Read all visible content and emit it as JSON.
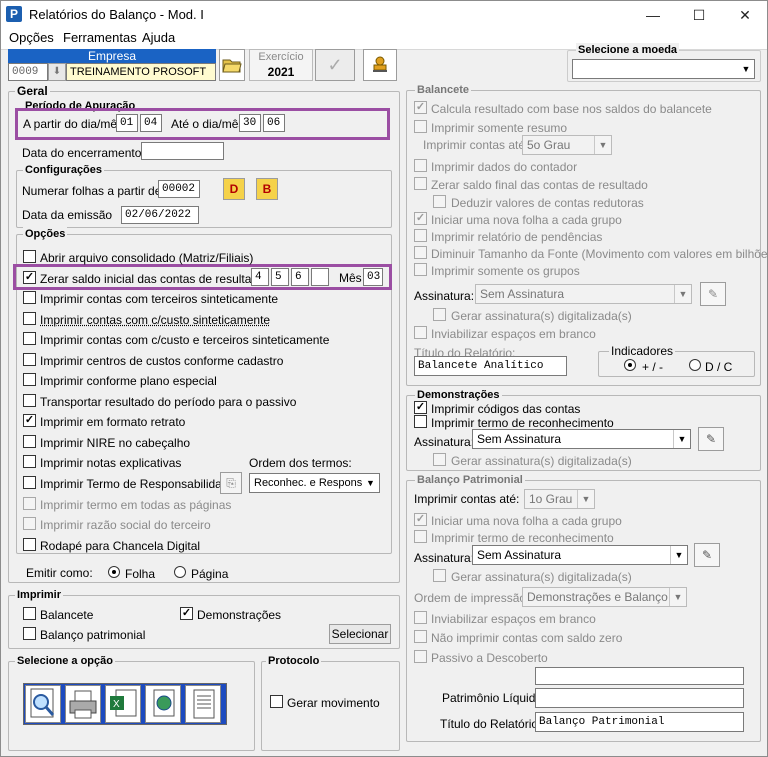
{
  "window": {
    "title": "Relatórios do Balanço - Mod. I",
    "minimize": "—",
    "maximize": "☐",
    "close": "✕",
    "app_icon": "P"
  },
  "menu": [
    "Opções",
    "Ferramentas",
    "Ajuda"
  ],
  "empresa": {
    "header": "Empresa",
    "code": "0009",
    "name": "TREINAMENTO PROSOFT"
  },
  "exercicio": {
    "label": "Exercício",
    "value": "2021"
  },
  "moeda": {
    "legend": "Selecione a moeda",
    "value": ""
  },
  "geral": {
    "legend": "Geral",
    "periodo": {
      "legend": "Período de Apuração",
      "from_label": "A partir do dia/mês",
      "from_day": "01",
      "from_month": "04",
      "to_label": "Até o dia/mês",
      "to_day": "30",
      "to_month": "06"
    },
    "encerramento_label": "Data do encerramento",
    "encerramento_value": "",
    "config": {
      "legend": "Configurações",
      "numerar_label": "Numerar folhas a partir de",
      "numerar_value": "00002",
      "btn_d": "D",
      "btn_b": "B",
      "emissao_label": "Data da emissão",
      "emissao_value": "02/06/2022"
    },
    "opcoes": {
      "legend": "Opções",
      "items": [
        {
          "label": "Abrir arquivo consolidado (Matriz/Filiais)",
          "checked": false,
          "disabled": false
        },
        {
          "label": "Zerar saldo inicial das contas de resultado",
          "checked": true,
          "disabled": false
        },
        {
          "label": "Imprimir contas com terceiros sinteticamente",
          "checked": false,
          "disabled": false
        },
        {
          "label": "Imprimir contas com c/custo sinteticamente",
          "checked": false,
          "disabled": false
        },
        {
          "label": "Imprimir contas com c/custo e terceiros sinteticamente",
          "checked": false,
          "disabled": false
        },
        {
          "label": "Imprimir centros de custos conforme cadastro",
          "checked": false,
          "disabled": false
        },
        {
          "label": "Imprimir conforme plano especial",
          "checked": false,
          "disabled": false
        },
        {
          "label": "Transportar resultado do período para o passivo",
          "checked": false,
          "disabled": false
        },
        {
          "label": "Imprimir em formato retrato",
          "checked": true,
          "disabled": false
        },
        {
          "label": "Imprimir NIRE no cabeçalho",
          "checked": false,
          "disabled": false
        },
        {
          "label": "Imprimir notas explicativas",
          "checked": false,
          "disabled": false
        },
        {
          "label": "Imprimir Termo de Responsabilidade",
          "checked": false,
          "disabled": false
        },
        {
          "label": "Imprimir termo em todas as páginas",
          "checked": false,
          "disabled": true
        },
        {
          "label": "Imprimir razão social do terceiro",
          "checked": false,
          "disabled": true
        },
        {
          "label": "Rodapé para Chancela Digital",
          "checked": false,
          "disabled": false
        }
      ],
      "zerar_months": [
        "4",
        "5",
        "6",
        ""
      ],
      "mes_label": "Mês",
      "mes_value": "03",
      "ordem_label": "Ordem dos termos:",
      "ordem_value": "Reconhec. e Respons."
    },
    "emitir": {
      "label": "Emitir como:",
      "folha": "Folha",
      "pagina": "Página"
    }
  },
  "imprimir": {
    "legend": "Imprimir",
    "balancete": "Balancete",
    "demonstracoes": "Demonstrações",
    "balanco": "Balanço patrimonial",
    "selecionar": "Selecionar"
  },
  "opcao": {
    "legend": "Selecione a opção"
  },
  "protocolo": {
    "legend": "Protocolo",
    "gerar": "Gerar movimento"
  },
  "balancete": {
    "legend": "Balancete",
    "items": [
      "Calcula resultado com base nos saldos do balancete",
      "Imprimir somente resumo",
      "Imprimir dados do contador",
      "Zerar saldo final das contas de resultado",
      "Deduzir valores de contas redutoras",
      "Iniciar uma nova folha a cada grupo",
      "Imprimir relatório de pendências",
      "Diminuir Tamanho da Fonte (Movimento com valores em bilhões)",
      "Imprimir somente os grupos",
      "Gerar assinatura(s) digitalizada(s)",
      "Inviabilizar espaços em branco"
    ],
    "contas_ate_label": "Imprimir contas até:",
    "contas_ate_value": "5o Grau",
    "assinatura_label": "Assinatura:",
    "assinatura_value": "Sem Assinatura",
    "titulo_label": "Título do Relatório:",
    "titulo_value": "Balancete Analítico",
    "indicadores": {
      "legend": "Indicadores",
      "opt1": "+ / -",
      "opt2": "D / C"
    }
  },
  "demonstracoes": {
    "legend": "Demonstrações",
    "codigos": "Imprimir códigos das contas",
    "termo": "Imprimir termo de reconhecimento",
    "assinatura_label": "Assinatura:",
    "assinatura_value": "Sem Assinatura",
    "gerar": "Gerar assinatura(s) digitalizada(s)"
  },
  "balanco": {
    "legend": "Balanço Patrimonial",
    "contas_ate_label": "Imprimir contas até:",
    "contas_ate_value": "1o Grau",
    "nova_folha": "Iniciar uma nova folha a cada grupo",
    "termo": "Imprimir termo de reconhecimento",
    "assinatura_label": "Assinatura:",
    "assinatura_value": "Sem Assinatura",
    "gerar": "Gerar assinatura(s) digitalizada(s)",
    "ordem_label": "Ordem de impressão:",
    "ordem_value": "Demonstrações e Balanço",
    "inviabilizar": "Inviabilizar espaços em branco",
    "nao_imprimir": "Não imprimir contas com saldo zero",
    "passivo": "Passivo a Descoberto",
    "patrimonio_label": "Patrimônio Líquido",
    "titulo_label": "Título do Relatório:",
    "titulo_value": "Balanço Patrimonial"
  }
}
